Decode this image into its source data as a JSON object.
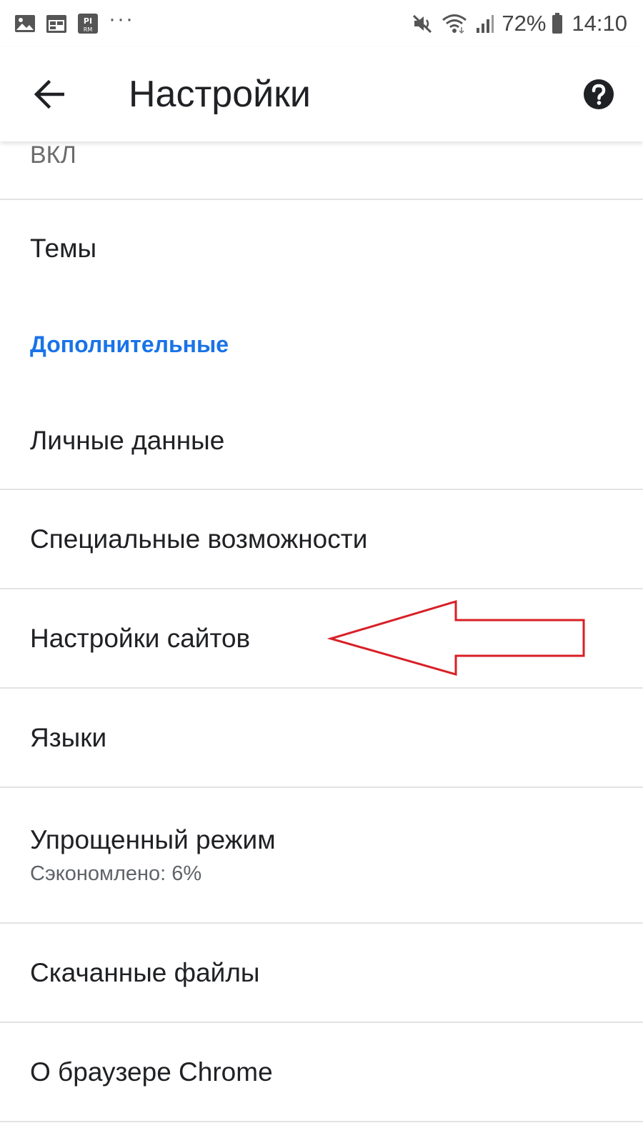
{
  "status_bar": {
    "battery": "72%",
    "time": "14:10",
    "icons_left": [
      "image-icon",
      "calendar-icon",
      "rm-app-icon",
      "more-dots-icon"
    ],
    "icons_right": [
      "mute-icon",
      "wifi-icon",
      "signal-icon",
      "battery-icon"
    ],
    "dots": "···"
  },
  "app_bar": {
    "title": "Настройки"
  },
  "settings": {
    "partial_summary": "ВКЛ",
    "themes": "Темы",
    "advanced_header": "Дополнительные",
    "personal_data": "Личные данные",
    "accessibility": "Специальные возможности",
    "site_settings": "Настройки сайтов",
    "languages": "Языки",
    "lite_mode": "Упрощенный режим",
    "lite_mode_summary": "Сэкономлено: 6%",
    "downloads": "Скачанные файлы",
    "about_chrome": "О браузере Chrome"
  },
  "colors": {
    "accent": "#1a73e8",
    "annotation": "#d81f26"
  }
}
